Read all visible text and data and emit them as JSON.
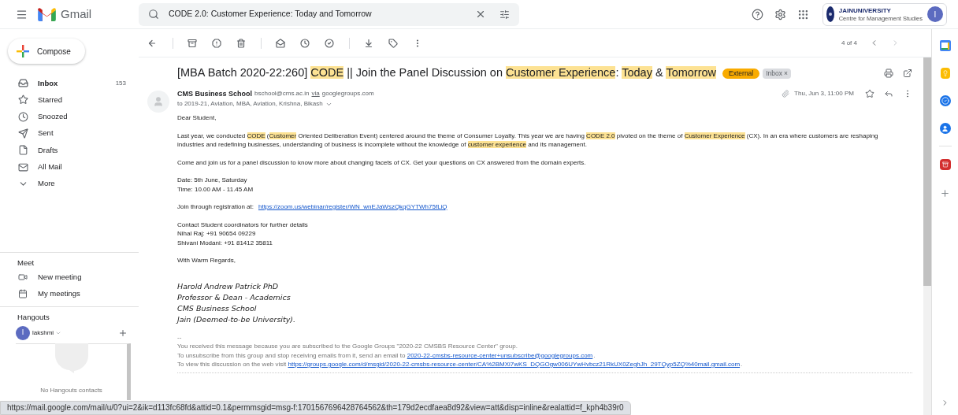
{
  "header": {
    "app_name": "Gmail",
    "search": {
      "value": "CODE 2.0: Customer Experience: Today and Tomorrow"
    },
    "org_logo": {
      "name": "JAINUNIVERSITY",
      "tagline": "Centre for Management Studies"
    },
    "avatar": "I"
  },
  "compose": "Compose",
  "sidebar": {
    "items": [
      {
        "label": "Inbox",
        "count": "153",
        "unread": true
      },
      {
        "label": "Starred",
        "unread": false
      },
      {
        "label": "Snoozed",
        "unread": false
      },
      {
        "label": "Sent",
        "unread": false
      },
      {
        "label": "Drafts",
        "unread": false
      },
      {
        "label": "All Mail",
        "unread": false
      },
      {
        "label": "More",
        "unread": false
      }
    ]
  },
  "meet": {
    "title": "Meet",
    "items": [
      "New meeting",
      "My meetings"
    ]
  },
  "hangouts": {
    "title": "Hangouts",
    "user": {
      "initial": "l",
      "name": "lakshmi"
    },
    "empty_text": "No Hangouts contacts"
  },
  "toolbar": {
    "pager": "4 of 4"
  },
  "subject": [
    {
      "text": "[MBA Batch 2020-22:260] ",
      "highlight": false
    },
    {
      "text": "CODE",
      "highlight": true
    },
    {
      "text": " || Join the Panel Discussion on ",
      "highlight": false
    },
    {
      "text": "Customer Experience",
      "highlight": true
    },
    {
      "text": ": ",
      "highlight": false
    },
    {
      "text": "Today",
      "highlight": true
    },
    {
      "text": " & ",
      "highlight": false
    },
    {
      "text": "Tomorrow",
      "highlight": true
    }
  ],
  "labels": [
    {
      "text": "External",
      "kind": "warning"
    },
    {
      "text": "Inbox",
      "kind": "removable",
      "remove": "×"
    }
  ],
  "message": {
    "sender": "CMS Business School",
    "email": "bschool@cms.ac.in",
    "via": "via",
    "domain": "googlegroups.com",
    "recipients": "to 2019-21, Aviation, MBA, Aviation, Krishna, Bikash",
    "date": "Thu, Jun 3, 11:00 PM"
  },
  "body": [
    {
      "kind": "lines",
      "lines": [
        "Dear Student,"
      ]
    },
    {
      "kind": "paragraph",
      "segments": [
        {
          "text": "Last year, we conducted ",
          "highlight": false
        },
        {
          "text": "CODE",
          "highlight": true
        },
        {
          "text": " (",
          "highlight": false
        },
        {
          "text": "Customer",
          "highlight": true
        },
        {
          "text": " Oriented Deliberation Event) centered around the theme of Consumer Loyalty. This year we are having ",
          "highlight": false
        },
        {
          "text": "CODE 2.0",
          "highlight": true
        },
        {
          "text": " pivoted on the theme of ",
          "highlight": false
        },
        {
          "text": "Customer Experience",
          "highlight": true
        },
        {
          "text": " (CX). In an era where customers are reshaping industries and redefining businesses, understanding of business is incomplete without the knowledge of ",
          "highlight": false
        },
        {
          "text": "customer experience",
          "highlight": true
        },
        {
          "text": " and its management.",
          "highlight": false
        }
      ]
    },
    {
      "kind": "lines",
      "lines": [
        "Come and join us for a panel discussion to know more about changing facets of CX. Get your questions on CX answered from the domain experts."
      ]
    },
    {
      "kind": "lines",
      "lines": [
        "Date: 5th June, Saturday",
        "Time: 10.00 AM - 11.45 AM"
      ]
    },
    {
      "kind": "link_line",
      "text": "Join through registration at:",
      "link": "https://zoom.us/webinar/register/WN_wnEJaWszQkqGYTWh75fLiQ"
    },
    {
      "kind": "lines",
      "lines": [
        "Contact Student coordinators for further details",
        "Nihal Raj: +91 90654 09229",
        "Shivani Modani: +91 81412 35811"
      ]
    },
    {
      "kind": "lines",
      "lines": [
        "With Warm Regards,"
      ]
    },
    {
      "kind": "signature",
      "lines": [
        "Harold Andrew Patrick PhD",
        "Professor & Dean - Academics",
        "CMS Business School",
        "Jain (Deemed-to-be University)."
      ]
    },
    {
      "kind": "footer",
      "separator": "--",
      "lines": [
        {
          "text": "You received this message because you are subscribed to the Google Groups \"2020-22 CMSBS Resource Center\" group."
        },
        {
          "text": "To unsubscribe from this group and stop receiving emails from it, send an email to ",
          "link": "2020-22-cmsbs-resource-center+unsubscribe@googlegroups.com",
          "end": "."
        },
        {
          "text": "To view this discussion on the web visit ",
          "link": "https://groups.google.com/d/msgid/2020-22-cmsbs-resource-center/CA%2BMXi7wKS_DQGOgw006UYwHvbcz21RkUX0ZeghJh_29TQyp5ZQ%40mail.gmail.com",
          "end": "."
        }
      ]
    }
  ],
  "status_url": "https://mail.google.com/mail/u/0?ui=2&ik=d113fc68fd&attid=0.1&permmsgid=msg-f:1701567696428764562&th=179d2ecdfaea8d92&view=att&disp=inline&realattid=f_kph4b39r0"
}
